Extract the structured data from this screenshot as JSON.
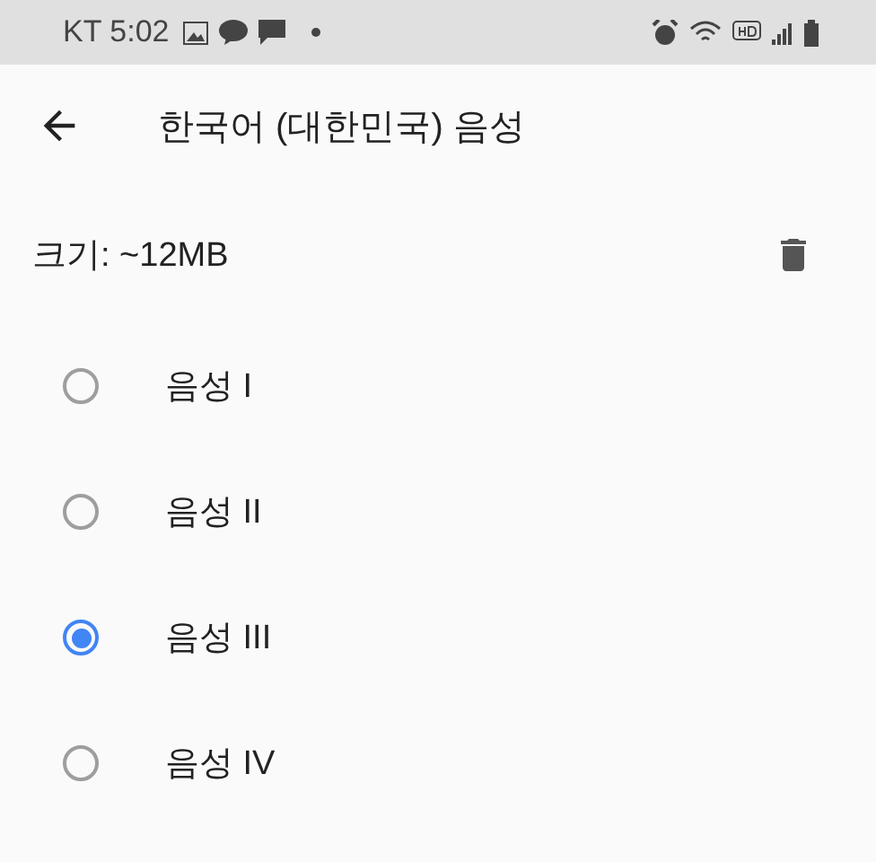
{
  "status_bar": {
    "carrier_time": "KT 5:02"
  },
  "header": {
    "title": "한국어 (대한민국) 음성"
  },
  "size": {
    "label": "크기: ~12MB"
  },
  "voices": [
    {
      "label": "음성 I",
      "selected": false
    },
    {
      "label": "음성 II",
      "selected": false
    },
    {
      "label": "음성 III",
      "selected": true
    },
    {
      "label": "음성 IV",
      "selected": false
    }
  ]
}
